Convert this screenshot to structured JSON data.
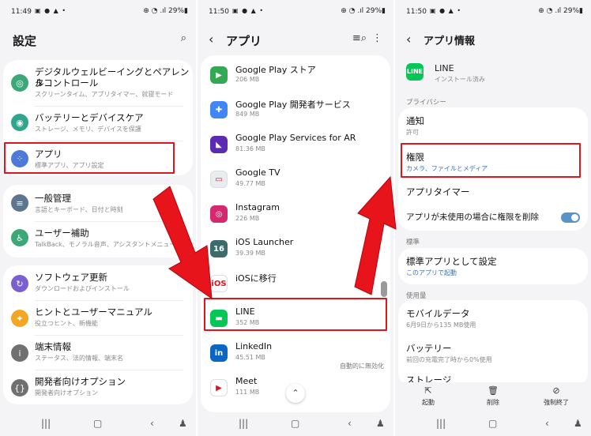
{
  "panel1": {
    "status": {
      "time": "11:49",
      "icons": "▣ ● ▲ •",
      "right": "⊕ ◔ .ıl 29%▮"
    },
    "title": "設定",
    "search_icon": "⌕",
    "items": [
      {
        "title": "デジタルウェルビーイングとペアレンタ",
        "title2": "ルコントロール",
        "sub": "スクリーンタイム、アプリタイマー、就寝モード"
      },
      {
        "title": "バッテリーとデバイスケア",
        "sub": "ストレージ、メモリ、デバイスを保護"
      },
      {
        "title": "アプリ",
        "sub": "標準アプリ、アプリ設定"
      },
      {
        "title": "一般管理",
        "sub": "言語とキーボード、日付と時刻"
      },
      {
        "title": "ユーザー補助",
        "sub": "TalkBack、モノラル音声、アシスタントメニュー"
      },
      {
        "title": "ソフトウェア更新",
        "sub": "ダウンロードおよびインストール"
      },
      {
        "title": "ヒントとユーザーマニュアル",
        "sub": "役立つヒント、新機能"
      },
      {
        "title": "端末情報",
        "sub": "ステータス、法的情報、端末名"
      },
      {
        "title": "開発者向けオプション",
        "sub": "開発者向けオプション"
      }
    ]
  },
  "panel2": {
    "status": {
      "time": "11:50",
      "icons": "▣ ● ▲ •",
      "right": "⊕ ◔ .ıl 29%▮"
    },
    "title": "アプリ",
    "apps": [
      {
        "name": "Google Play ストア",
        "size": "206 MB",
        "color": "#34a853",
        "glyph": "▶"
      },
      {
        "name": "Google Play 開発者サービス",
        "size": "849 MB",
        "color": "#4285f4",
        "glyph": "✚"
      },
      {
        "name": "Google Play Services for AR",
        "size": "81.36 MB",
        "color": "#5b2bb3",
        "glyph": "◣"
      },
      {
        "name": "Google TV",
        "size": "49.77 MB",
        "color": "#e9edf2",
        "glyph": "▭"
      },
      {
        "name": "Instagram",
        "size": "226 MB",
        "color": "#d6286f",
        "glyph": "◎"
      },
      {
        "name": "iOS Launcher",
        "size": "39.39 MB",
        "color": "#3d6a6a",
        "glyph": "16"
      },
      {
        "name": "iOSに移行",
        "size": "",
        "color": "#ffffff",
        "glyph": "iOS"
      },
      {
        "name": "LINE",
        "size": "352 MB",
        "color": "#06c755",
        "glyph": "▬"
      },
      {
        "name": "LinkedIn",
        "size": "45.51 MB",
        "color": "#0a66c2",
        "glyph": "in"
      },
      {
        "name": "Meet",
        "size": "111 MB",
        "color": "#ffffff",
        "glyph": "▶"
      }
    ],
    "auto_disabled": "自動的に無効化"
  },
  "panel3": {
    "status": {
      "time": "11:50",
      "icons": "▣ ● ▲ •",
      "right": "⊕ ◔ .ıl 29%▮"
    },
    "title": "アプリ情報",
    "app_name": "LINE",
    "app_status": "インストール済み",
    "privacy_label": "プライバシー",
    "notification": {
      "title": "通知",
      "sub": "許可"
    },
    "permission": {
      "title": "権限",
      "sub": "カメラ、ファイルとメディア"
    },
    "app_timer": "アプリタイマー",
    "remove_permission": "アプリが未使用の場合に権限を削除",
    "default_label": "標準",
    "default_app": {
      "title": "標準アプリとして設定",
      "sub": "このアプリで起動"
    },
    "usage_label": "使用量",
    "mobile_data": {
      "title": "モバイルデータ",
      "sub": "6月9日から135 MB使用"
    },
    "battery": {
      "title": "バッテリー",
      "sub": "前回の充電完了時から0%使用"
    },
    "storage": {
      "title": "ストレージ"
    },
    "actions": {
      "open": "起動",
      "uninstall": "削除",
      "force_stop": "強制終了"
    }
  },
  "colors": {
    "highlight": "#e0141e",
    "arrow": "#e8141c",
    "toggle": "#5a93c8"
  }
}
